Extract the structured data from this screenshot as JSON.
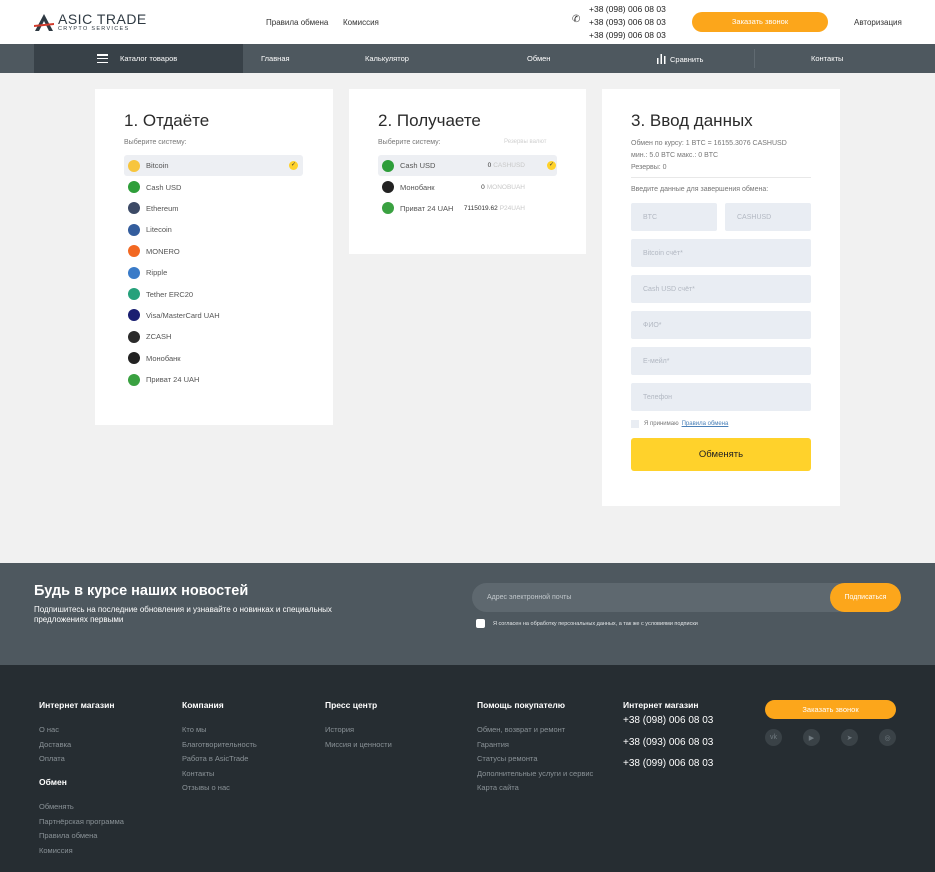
{
  "header": {
    "logo_title": "ASIC TRADE",
    "logo_sub": "CRYPTO SERVICES",
    "links": [
      "Правила обмена",
      "Комиссия"
    ],
    "phones": [
      "+38 (098) 006 08 03",
      "+38 (093) 006 08 03",
      "+38 (099) 006 08 03"
    ],
    "call_button": "Заказать звонок",
    "auth": "Авторизация"
  },
  "nav": {
    "catalog": "Каталог товаров",
    "items": [
      "Главная",
      "Калькулятор",
      "Обмен",
      "Сравнить",
      "Контакты"
    ]
  },
  "give": {
    "title": "1. Отдаёте",
    "hint": "Выберите систему:",
    "systems": [
      {
        "label": "Bitcoin",
        "icon": "bitcoin-icon",
        "color": "#f7c53d",
        "selected": true
      },
      {
        "label": "Cash USD",
        "icon": "cash-usd-icon",
        "color": "#2e9e3a"
      },
      {
        "label": "Ethereum",
        "icon": "ethereum-icon",
        "color": "#3c4a66"
      },
      {
        "label": "Litecoin",
        "icon": "litecoin-icon",
        "color": "#345d9d"
      },
      {
        "label": "MONERO",
        "icon": "monero-icon",
        "color": "#f26822"
      },
      {
        "label": "Ripple",
        "icon": "ripple-icon",
        "color": "#3a7bc8"
      },
      {
        "label": "Tether ERC20",
        "icon": "tether-icon",
        "color": "#26a17b"
      },
      {
        "label": "Visa/MasterCard UAH",
        "icon": "visa-mastercard-icon",
        "color": "#1a1f71"
      },
      {
        "label": "ZCASH",
        "icon": "zcash-icon",
        "color": "#2b2b2b"
      },
      {
        "label": "Монобанк",
        "icon": "monobank-icon",
        "color": "#222222"
      },
      {
        "label": "Приват 24 UAH",
        "icon": "privat24-icon",
        "color": "#3aa141"
      }
    ]
  },
  "receive": {
    "title": "2. Получаете",
    "hint": "Выберите систему:",
    "reserves_label": "Резервы валют",
    "systems": [
      {
        "label": "Cash USD",
        "icon": "cash-usd-icon",
        "color": "#2e9e3a",
        "amount": "0",
        "currency": "CASHUSD",
        "selected": true
      },
      {
        "label": "Монобанк",
        "icon": "monobank-icon",
        "color": "#222222",
        "amount": "0",
        "currency": "MONOBUAH"
      },
      {
        "label": "Приват 24 UAH",
        "icon": "privat24-icon",
        "color": "#3aa141",
        "amount": "7115019.62",
        "currency": "P24UAH"
      }
    ]
  },
  "form": {
    "title": "3. Ввод данных",
    "rate_line": "Обмен по курсу: 1 BTC = 16155.3076 CASHUSD",
    "limits_line": "мин.: 5.0 BTC макс.: 0 BTC",
    "reserves_line": "Резервы: 0",
    "hint": "Введите данные для завершения обмена:",
    "from_placeholder": "BTC",
    "to_placeholder": "CASHUSD",
    "fields": [
      "Bitcoin счёт*",
      "Cash USD счёт*",
      "ФИО*",
      "E-мейл*",
      "Телефон"
    ],
    "agree_text": "Я принимаю",
    "agree_link": "Правила обмена",
    "submit": "Обменять"
  },
  "newsletter": {
    "title": "Будь в курсе наших новостей",
    "text": "Подпишитесь на последние обновления и узнавайте о новинках и специальных предложениях первыми",
    "placeholder": "Адрес электронной почты",
    "button": "Подписаться",
    "consent": "Я согласен на обработку персональных данных, а так же с условиями подписки"
  },
  "footer": {
    "shop": {
      "title": "Интернет магазин",
      "links": [
        "О нас",
        "Доставка",
        "Оплата"
      ]
    },
    "exchange": {
      "title": "Обмен",
      "links": [
        "Обменять",
        "Партнёрская программа",
        "Правила обмена",
        "Комиссия"
      ]
    },
    "company": {
      "title": "Компания",
      "links": [
        "Кто мы",
        "Благотворительность",
        "Работа в AsicTrade",
        "Контакты",
        "Отзывы о нас"
      ]
    },
    "press": {
      "title": "Пресс центр",
      "links": [
        "История",
        "Миссия и ценности"
      ]
    },
    "help": {
      "title": "Помощь покупателю",
      "links": [
        "Обмен, возврат и ремонт",
        "Гарантия",
        "Статусы ремонта",
        "Дополнительные услуги и сервис",
        "Карта сайта"
      ]
    },
    "contact_title": "Интернет магазин",
    "phones": [
      "+38 (098) 006 08 03",
      "+38 (093) 006 08 03",
      "+38 (099) 006 08 03"
    ],
    "call_button": "Заказать звонок",
    "social": [
      "vk-icon",
      "youtube-icon",
      "telegram-icon",
      "instagram-icon"
    ]
  }
}
